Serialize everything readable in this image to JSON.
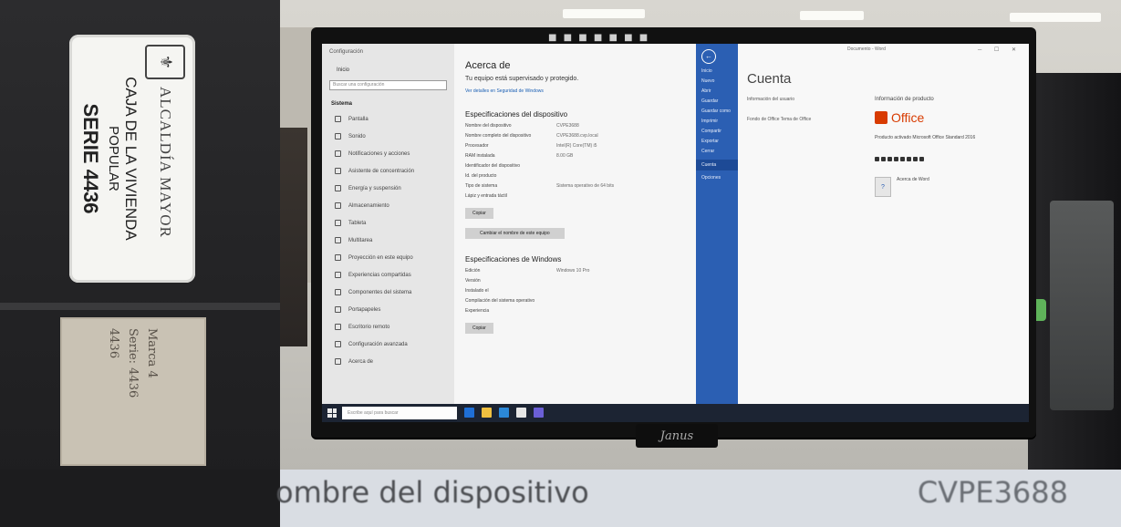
{
  "sticker": {
    "entity": "ALCALDÍA MAYOR",
    "line1": "CAJA DE LA VIVIENDA",
    "line2": "POPULAR",
    "serie": "SERIE 4436"
  },
  "paper_tag": {
    "lines": [
      "Marca 4",
      "Serie: 4436",
      "4436"
    ]
  },
  "settings": {
    "window_title": "Configuración",
    "home": "Inicio",
    "search_placeholder": "Buscar una configuración",
    "section": "Sistema",
    "nav_items": [
      "Pantalla",
      "Sonido",
      "Notificaciones y acciones",
      "Asistente de concentración",
      "Energía y suspensión",
      "Almacenamiento",
      "Tableta",
      "Multitarea",
      "Proyección en este equipo",
      "Experiencias compartidas",
      "Componentes del sistema",
      "Portapapeles",
      "Escritorio remoto",
      "Configuración avanzada",
      "Acerca de"
    ],
    "content_title": "Acerca de",
    "content_sub": "Tu equipo está supervisado y protegido.",
    "content_link": "Ver detalles en Seguridad de Windows",
    "device_heading": "Especificaciones del dispositivo",
    "device_specs": [
      {
        "k": "Nombre del dispositivo",
        "v": "CVPE3688"
      },
      {
        "k": "Nombre completo del dispositivo",
        "v": "CVPE3688.cvp.local"
      },
      {
        "k": "Procesador",
        "v": "Intel(R) Core(TM) i5"
      },
      {
        "k": "RAM instalada",
        "v": "8.00 GB"
      },
      {
        "k": "Identificador del dispositivo",
        "v": ""
      },
      {
        "k": "Id. del producto",
        "v": ""
      },
      {
        "k": "Tipo de sistema",
        "v": "Sistema operativo de 64 bits"
      },
      {
        "k": "Lápiz y entrada táctil",
        "v": ""
      }
    ],
    "copy_button": "Copiar",
    "rename_button": "Cambiar el nombre de este equipo",
    "windows_heading": "Especificaciones de Windows",
    "windows_specs": [
      {
        "k": "Edición",
        "v": "Windows 10 Pro"
      },
      {
        "k": "Versión",
        "v": ""
      },
      {
        "k": "Instalado el",
        "v": ""
      },
      {
        "k": "Compilación del sistema operativo",
        "v": ""
      },
      {
        "k": "Experiencia",
        "v": ""
      }
    ],
    "copy_button2": "Copiar"
  },
  "office": {
    "window_title": "Documento - Word",
    "rail_items": [
      "Inicio",
      "Nuevo",
      "Abrir",
      "Guardar",
      "Guardar como",
      "Imprimir",
      "Compartir",
      "Exportar",
      "Cerrar",
      "Cuenta",
      "Opciones"
    ],
    "active_rail": "Cuenta",
    "title": "Cuenta",
    "user_info": "Información del usuario",
    "user_block": "Fondo de Office\nTema de Office",
    "product_info": "Información de producto",
    "logo": "Office",
    "product": "Producto activado\nMicrosoft Office Standard 2016",
    "about_icon": "?",
    "about_text": "Acerca de Word"
  },
  "taskbar": {
    "search_placeholder": "Escribe aquí para buscar",
    "clock": "",
    "app_colors": [
      "#1f6fd6",
      "#f0c040",
      "#2b88d8",
      "#e6e6e6",
      "#6b5fd6"
    ]
  },
  "zoom": {
    "label": "ombre del dispositivo",
    "value": "CVPE3688"
  }
}
